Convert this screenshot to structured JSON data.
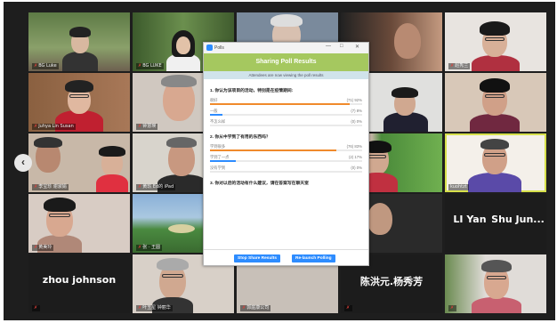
{
  "poll_window": {
    "app_name": "Polls",
    "minimize": "—",
    "maximize": "□",
    "close": "✕",
    "title": "Sharing Poll Results",
    "subtitle": "Attendees are now viewing the poll results",
    "questions": [
      {
        "text": "1. 你认为该项目的活动，特别是在疫情期间:",
        "options": [
          {
            "label": "很好",
            "stat": "(71) 92%",
            "value": 92
          },
          {
            "label": "一般",
            "stat": "(7) 8%",
            "value": 8
          },
          {
            "label": "不怎么样",
            "stat": "(0) 0%",
            "value": 0
          }
        ]
      },
      {
        "text": "2. 你从中学到了有用的东西吗？",
        "options": [
          {
            "label": "学到很多",
            "stat": "(76) 83%",
            "value": 83
          },
          {
            "label": "学到了一点",
            "stat": "(2) 17%",
            "value": 17
          },
          {
            "label": "没有学到",
            "stat": "(0) 0%",
            "value": 0
          }
        ]
      },
      {
        "text": "3. 你对以后的活动有什么建议，请在答案写在聊天室",
        "options": []
      }
    ],
    "stop_button": "Stop Share Results",
    "relaunch_button": "Re-launch Polling"
  },
  "colors": {
    "poll_header": "#a5c85f",
    "bar_orange": "#f08a2c",
    "bar_blue": "#2d8cff",
    "button_blue": "#2d8cff",
    "active_speaker": "#d6e04a"
  },
  "participants": [
    {
      "name": "BG Luke",
      "muted": true
    },
    {
      "name": "BG LUKE",
      "muted": true
    },
    {
      "name": "",
      "muted": false
    },
    {
      "name": "",
      "muted": false
    },
    {
      "name": "赵秀兰",
      "muted": true
    },
    {
      "name": "Juhya Lin Susan",
      "muted": true
    },
    {
      "name": "钟慧瑛",
      "muted": true
    },
    {
      "name": "",
      "muted": false
    },
    {
      "name": "",
      "muted": false
    },
    {
      "name": "",
      "muted": false
    },
    {
      "name": "李宝珍 谢淑娟",
      "muted": true
    },
    {
      "name": "黄玖 Ed的 iPad",
      "muted": true
    },
    {
      "name": "",
      "muted": false
    },
    {
      "name": "",
      "muted": false
    },
    {
      "name": "kuohtzt",
      "muted": true
    },
    {
      "name": "黄美玲",
      "muted": true
    },
    {
      "name": "张 · 王圆",
      "muted": true
    },
    {
      "name": "",
      "muted": false
    },
    {
      "name": "",
      "muted": false
    },
    {
      "name": "",
      "muted": false
    },
    {
      "name": "",
      "muted": true
    },
    {
      "name": "叶玉星 钟丽华",
      "muted": true
    },
    {
      "name": "郭庭康公司",
      "muted": true
    },
    {
      "name": "",
      "muted": true
    },
    {
      "name": "",
      "muted": true
    }
  ],
  "name_cards": {
    "zhou": "zhou johnson",
    "li": "LI Yan",
    "shu": "Shu Jun...",
    "chen": "陈洪元.杨秀芳"
  },
  "nav": {
    "prev": "‹"
  }
}
